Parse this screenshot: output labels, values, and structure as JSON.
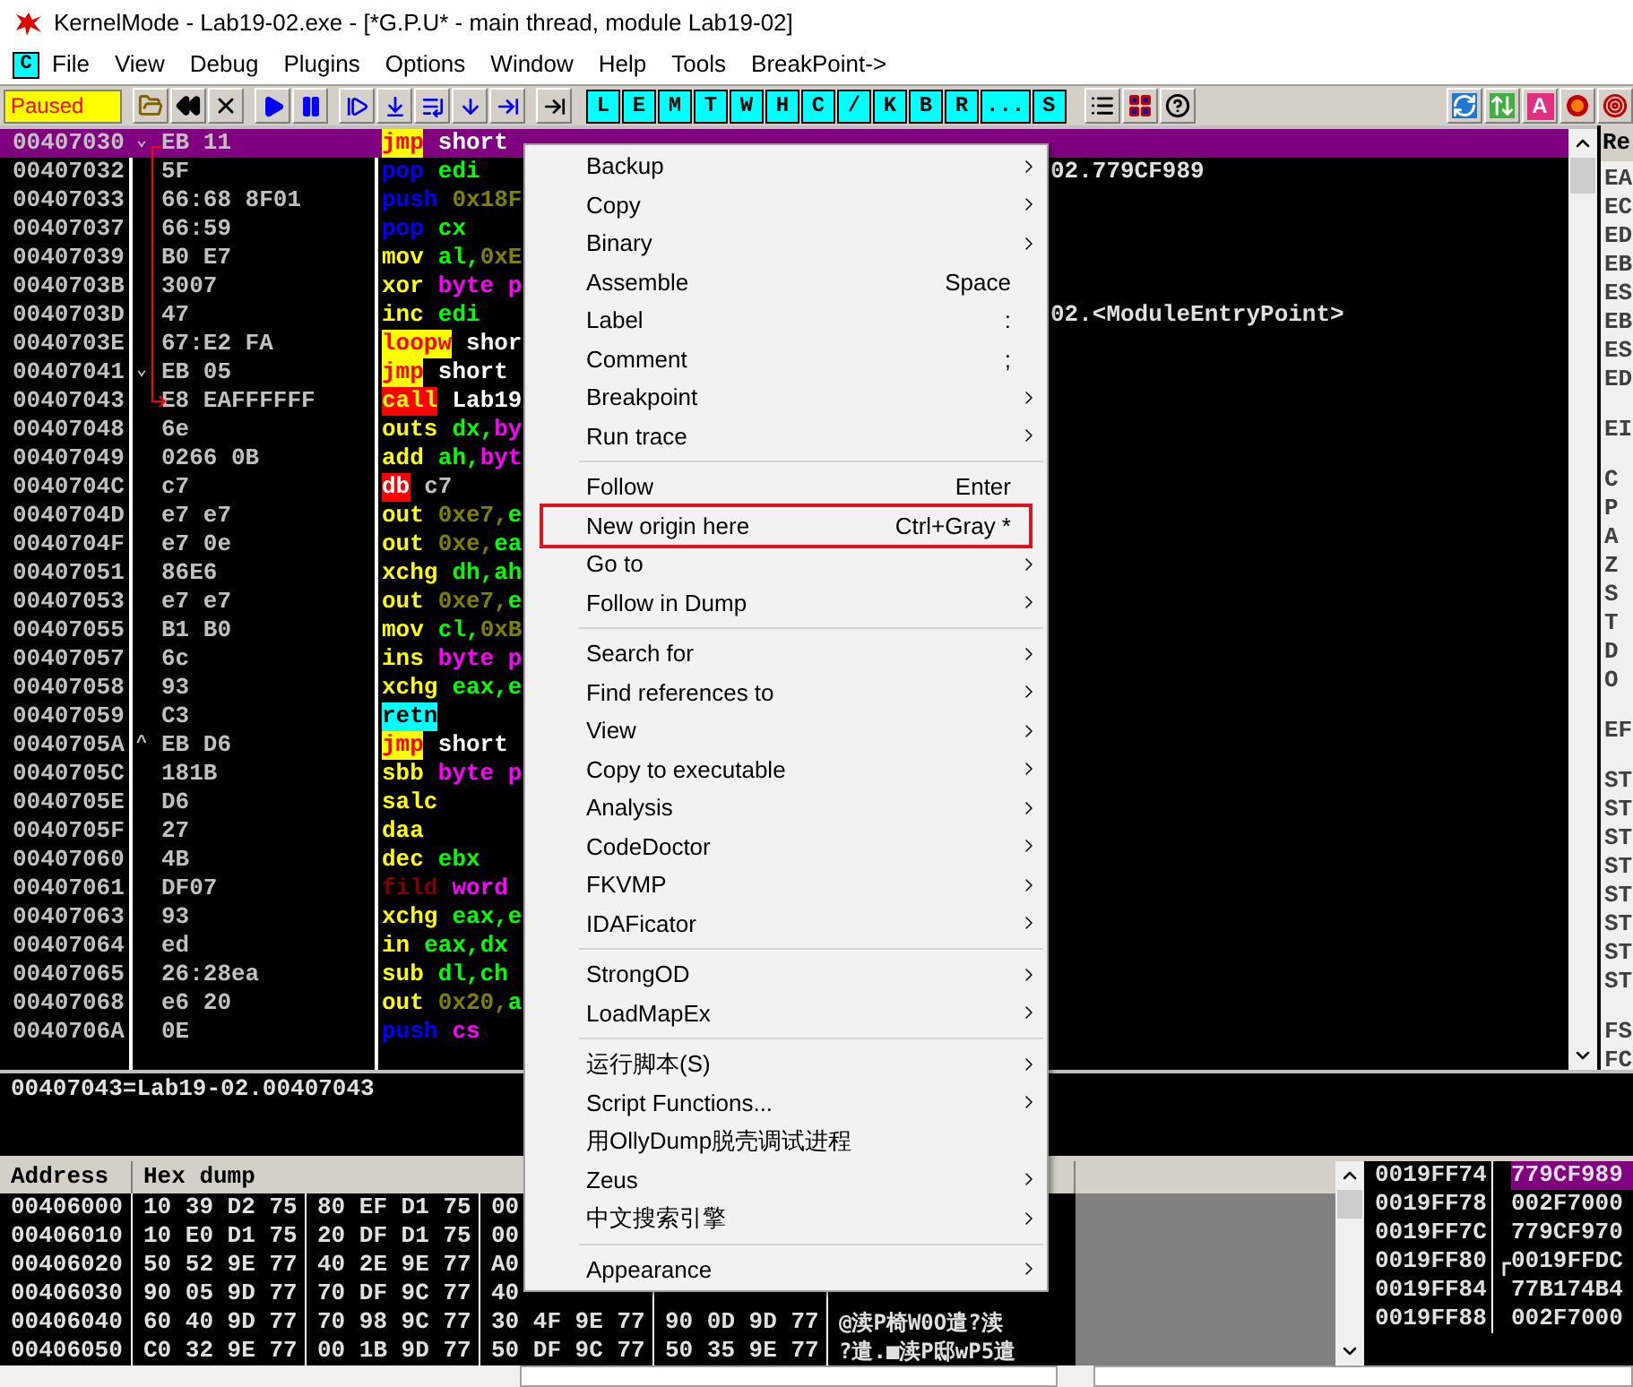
{
  "window": {
    "title": "KernelMode - Lab19-02.exe - [*G.P.U* - main thread, module Lab19-02]"
  },
  "menu_bar": {
    "badge": "C",
    "items": [
      "File",
      "View",
      "Debug",
      "Plugins",
      "Options",
      "Window",
      "Help",
      "Tools",
      "BreakPoint->"
    ]
  },
  "toolbar": {
    "status": "Paused",
    "letter_buttons": [
      "L",
      "E",
      "M",
      "T",
      "W",
      "H",
      "C",
      "/",
      "K",
      "B",
      "R",
      "...",
      "S"
    ],
    "letter_badge": "A"
  },
  "disassembly": {
    "rows": [
      {
        "address": "00407030",
        "marker": "⌄",
        "bytes": "EB 11",
        "selected": true,
        "mnemonic": {
          "text": "jmp",
          "kind": "jump"
        },
        "operands": [
          {
            "text": "short",
            "kind": "label"
          }
        ]
      },
      {
        "address": "00407032",
        "bytes": "5F",
        "comment": "02.779CF989",
        "selected": false,
        "mnemonic": {
          "text": "pop",
          "kind": "stack"
        },
        "operands": [
          {
            "text": "edi",
            "kind": "reg"
          }
        ]
      },
      {
        "address": "00407033",
        "bytes": "66:68 8F01",
        "selected": false,
        "mnemonic": {
          "text": "push",
          "kind": "stack"
        },
        "operands": [
          {
            "text": "0x18F",
            "kind": "imm"
          }
        ]
      },
      {
        "address": "00407037",
        "bytes": "66:59",
        "selected": false,
        "mnemonic": {
          "text": "pop",
          "kind": "stack"
        },
        "operands": [
          {
            "text": "cx",
            "kind": "reg"
          }
        ]
      },
      {
        "address": "00407039",
        "bytes": "B0 E7",
        "selected": false,
        "mnemonic": {
          "text": "mov",
          "kind": "op"
        },
        "operands": [
          {
            "text": "al,",
            "kind": "reg"
          },
          {
            "text": "0xE",
            "kind": "imm"
          }
        ]
      },
      {
        "address": "0040703B",
        "bytes": "3007",
        "selected": false,
        "mnemonic": {
          "text": "xor",
          "kind": "op"
        },
        "operands": [
          {
            "text": "byte p",
            "kind": "mem"
          }
        ]
      },
      {
        "address": "0040703D",
        "bytes": "47",
        "comment": "02.<ModuleEntryPoint>",
        "selected": false,
        "mnemonic": {
          "text": "inc",
          "kind": "op"
        },
        "operands": [
          {
            "text": "edi",
            "kind": "reg"
          }
        ]
      },
      {
        "address": "0040703E",
        "bytes": "67:E2 FA",
        "selected": false,
        "mnemonic": {
          "text": "loopw",
          "kind": "jump"
        },
        "operands": [
          {
            "text": "shor",
            "kind": "label"
          }
        ]
      },
      {
        "address": "00407041",
        "marker": "⌄",
        "bytes": "EB 05",
        "selected": false,
        "mnemonic": {
          "text": "jmp",
          "kind": "jump"
        },
        "operands": [
          {
            "text": "short",
            "kind": "label"
          }
        ]
      },
      {
        "address": "00407043",
        "bytes": "E8 EAFFFFFF",
        "selected": false,
        "mnemonic": {
          "text": "call",
          "kind": "call"
        },
        "operands": [
          {
            "text": "Lab19",
            "kind": "label"
          }
        ]
      },
      {
        "address": "00407048",
        "bytes": "6e",
        "selected": false,
        "mnemonic": {
          "text": "outs",
          "kind": "op"
        },
        "operands": [
          {
            "text": "dx,",
            "kind": "reg"
          },
          {
            "text": "by",
            "kind": "mem"
          }
        ]
      },
      {
        "address": "00407049",
        "bytes": "0266 0B",
        "selected": false,
        "mnemonic": {
          "text": "add",
          "kind": "op"
        },
        "operands": [
          {
            "text": "ah,",
            "kind": "reg"
          },
          {
            "text": "byt",
            "kind": "mem"
          }
        ]
      },
      {
        "address": "0040704C",
        "bytes": "c7",
        "selected": false,
        "mnemonic": {
          "text": "db",
          "kind": "bad"
        },
        "operands": [
          {
            "text": "c7",
            "kind": "plain"
          }
        ]
      },
      {
        "address": "0040704D",
        "bytes": "e7 e7",
        "selected": false,
        "mnemonic": {
          "text": "out",
          "kind": "op"
        },
        "operands": [
          {
            "text": "0xe7,",
            "kind": "imm"
          },
          {
            "text": "e",
            "kind": "reg"
          }
        ]
      },
      {
        "address": "0040704F",
        "bytes": "e7 0e",
        "selected": false,
        "mnemonic": {
          "text": "out",
          "kind": "op"
        },
        "operands": [
          {
            "text": "0xe,",
            "kind": "imm"
          },
          {
            "text": "ea",
            "kind": "reg"
          }
        ]
      },
      {
        "address": "00407051",
        "bytes": "86E6",
        "selected": false,
        "mnemonic": {
          "text": "xchg",
          "kind": "op"
        },
        "operands": [
          {
            "text": "dh,ah",
            "kind": "reg"
          }
        ]
      },
      {
        "address": "00407053",
        "bytes": "e7 e7",
        "selected": false,
        "mnemonic": {
          "text": "out",
          "kind": "op"
        },
        "operands": [
          {
            "text": "0xe7,",
            "kind": "imm"
          },
          {
            "text": "e",
            "kind": "reg"
          }
        ]
      },
      {
        "address": "00407055",
        "bytes": "B1 B0",
        "selected": false,
        "mnemonic": {
          "text": "mov",
          "kind": "op"
        },
        "operands": [
          {
            "text": "cl,",
            "kind": "reg"
          },
          {
            "text": "0xB",
            "kind": "imm"
          }
        ]
      },
      {
        "address": "00407057",
        "bytes": "6c",
        "selected": false,
        "mnemonic": {
          "text": "ins",
          "kind": "op"
        },
        "operands": [
          {
            "text": "byte p",
            "kind": "mem"
          }
        ]
      },
      {
        "address": "00407058",
        "bytes": "93",
        "selected": false,
        "mnemonic": {
          "text": "xchg",
          "kind": "op"
        },
        "operands": [
          {
            "text": "eax,e",
            "kind": "reg"
          }
        ]
      },
      {
        "address": "00407059",
        "bytes": "C3",
        "selected": false,
        "mnemonic": {
          "text": "retn",
          "kind": "ret"
        },
        "operands": []
      },
      {
        "address": "0040705A",
        "marker": "^",
        "bytes": "EB D6",
        "selected": false,
        "mnemonic": {
          "text": "jmp",
          "kind": "jump"
        },
        "operands": [
          {
            "text": "short",
            "kind": "label"
          }
        ]
      },
      {
        "address": "0040705C",
        "bytes": "181B",
        "selected": false,
        "mnemonic": {
          "text": "sbb",
          "kind": "op"
        },
        "operands": [
          {
            "text": "byte p",
            "kind": "mem"
          }
        ]
      },
      {
        "address": "0040705E",
        "bytes": "D6",
        "selected": false,
        "mnemonic": {
          "text": "salc",
          "kind": "op"
        },
        "operands": []
      },
      {
        "address": "0040705F",
        "bytes": "27",
        "selected": false,
        "mnemonic": {
          "text": "daa",
          "kind": "op"
        },
        "operands": []
      },
      {
        "address": "00407060",
        "bytes": "4B",
        "selected": false,
        "mnemonic": {
          "text": "dec",
          "kind": "op"
        },
        "operands": [
          {
            "text": "ebx",
            "kind": "reg"
          }
        ]
      },
      {
        "address": "00407061",
        "bytes": "DF07",
        "selected": false,
        "mnemonic": {
          "text": "fild",
          "kind": "fpu"
        },
        "operands": [
          {
            "text": "word",
            "kind": "mem"
          }
        ]
      },
      {
        "address": "00407063",
        "bytes": "93",
        "selected": false,
        "mnemonic": {
          "text": "xchg",
          "kind": "op"
        },
        "operands": [
          {
            "text": "eax,e",
            "kind": "reg"
          }
        ]
      },
      {
        "address": "00407064",
        "bytes": "ed",
        "selected": false,
        "mnemonic": {
          "text": "in",
          "kind": "op"
        },
        "operands": [
          {
            "text": "eax,dx",
            "kind": "reg"
          }
        ]
      },
      {
        "address": "00407065",
        "bytes": "26:28ea",
        "selected": false,
        "mnemonic": {
          "text": "sub",
          "kind": "op"
        },
        "operands": [
          {
            "text": "dl,ch",
            "kind": "reg"
          }
        ]
      },
      {
        "address": "00407068",
        "bytes": "e6 20",
        "selected": false,
        "mnemonic": {
          "text": "out",
          "kind": "op"
        },
        "operands": [
          {
            "text": "0x20,",
            "kind": "imm"
          },
          {
            "text": "a",
            "kind": "reg"
          }
        ]
      },
      {
        "address": "0040706A",
        "bytes": "0E",
        "selected": false,
        "mnemonic": {
          "text": "push",
          "kind": "stack"
        },
        "operands": [
          {
            "text": "cs",
            "kind": "mem"
          }
        ]
      }
    ]
  },
  "registers": {
    "header": "Re",
    "groups": [
      [
        "EA",
        "EC",
        "ED",
        "EB",
        "ES",
        "EB",
        "ES",
        "ED"
      ],
      [
        "EI"
      ],
      [
        "C",
        "P",
        "A",
        "Z",
        "S",
        "T",
        "D",
        "O"
      ],
      [
        "EF"
      ],
      [
        "ST",
        "ST",
        "ST",
        "ST",
        "ST",
        "ST",
        "ST",
        "ST"
      ],
      [
        "FS",
        "FC"
      ]
    ]
  },
  "info_pane": {
    "text": "00407043=Lab19-02.00407043"
  },
  "dump": {
    "columns": [
      "Address",
      "Hex dump"
    ],
    "rows": [
      {
        "address": "00406000",
        "hex": [
          "10 39 D2 75",
          "80 EF D1 75",
          "00"
        ]
      },
      {
        "address": "00406010",
        "hex": [
          "10 E0 D1 75",
          "20 DF D1 75",
          "00"
        ]
      },
      {
        "address": "00406020",
        "hex": [
          "50 52 9E 77",
          "40 2E 9E 77",
          "A0"
        ]
      },
      {
        "address": "00406030",
        "hex": [
          "90 05 9D 77",
          "70 DF 9C 77",
          "40"
        ]
      },
      {
        "address": "00406040",
        "hex": [
          "60 40 9D 77",
          "70 98 9C 77",
          "30 4F 9E 77",
          "90 0D 9D 77"
        ],
        "ascii": "@渎P椅W0O遣?渎"
      },
      {
        "address": "00406050",
        "hex": [
          "C0 32 9E 77",
          "00 1B 9D 77",
          "50 DF 9C 77",
          "50 35 9E 77"
        ],
        "ascii": "?遣.■渎P邸wP5遣"
      }
    ]
  },
  "stack": {
    "rows": [
      {
        "address": "0019FF74",
        "value": "779CF989",
        "selected": true,
        "frame_start": false
      },
      {
        "address": "0019FF78",
        "value": "002F7000",
        "selected": false,
        "frame_start": false
      },
      {
        "address": "0019FF7C",
        "value": "779CF970",
        "selected": false,
        "frame_start": false
      },
      {
        "address": "0019FF80",
        "value": "0019FFDC",
        "selected": false,
        "frame_start": true
      },
      {
        "address": "0019FF84",
        "value": "77B174B4",
        "selected": false,
        "frame_start": false
      },
      {
        "address": "0019FF88",
        "value": "002F7000",
        "selected": false,
        "frame_start": false
      }
    ]
  },
  "context_menu": {
    "groups": [
      [
        {
          "label": "Backup",
          "submenu": true,
          "outlined": false
        },
        {
          "label": "Copy",
          "submenu": true,
          "outlined": false
        },
        {
          "label": "Binary",
          "submenu": true,
          "outlined": false
        },
        {
          "label": "Assemble",
          "shortcut": "Space",
          "submenu": false,
          "outlined": false
        },
        {
          "label": "Label",
          "shortcut": ":",
          "submenu": false,
          "outlined": false
        },
        {
          "label": "Comment",
          "shortcut": ";",
          "submenu": false,
          "outlined": false
        },
        {
          "label": "Breakpoint",
          "submenu": true,
          "outlined": false
        },
        {
          "label": "Run trace",
          "submenu": true,
          "outlined": false
        }
      ],
      [
        {
          "label": "Follow",
          "shortcut": "Enter",
          "submenu": false,
          "outlined": false
        },
        {
          "label": "New origin here",
          "shortcut": "Ctrl+Gray *",
          "submenu": false,
          "outlined": true
        },
        {
          "label": "Go to",
          "submenu": true,
          "outlined": false
        },
        {
          "label": "Follow in Dump",
          "submenu": true,
          "outlined": false
        }
      ],
      [
        {
          "label": "Search for",
          "submenu": true,
          "outlined": false
        },
        {
          "label": "Find references to",
          "submenu": true,
          "outlined": false
        },
        {
          "label": "View",
          "submenu": true,
          "outlined": false
        },
        {
          "label": "Copy to executable",
          "submenu": true,
          "outlined": false
        },
        {
          "label": "Analysis",
          "submenu": true,
          "outlined": false
        },
        {
          "label": "CodeDoctor",
          "submenu": true,
          "outlined": false
        },
        {
          "label": "FKVMP",
          "submenu": true,
          "outlined": false
        },
        {
          "label": "IDAFicator",
          "submenu": true,
          "outlined": false
        }
      ],
      [
        {
          "label": "StrongOD",
          "submenu": true,
          "outlined": false
        },
        {
          "label": "LoadMapEx",
          "submenu": true,
          "outlined": false
        }
      ],
      [
        {
          "label": "运行脚本(S)",
          "submenu": true,
          "outlined": false
        },
        {
          "label": "Script Functions...",
          "submenu": true,
          "outlined": false
        },
        {
          "label": "用OllyDump脱壳调试进程",
          "submenu": false,
          "outlined": false
        },
        {
          "label": "Zeus",
          "submenu": true,
          "outlined": false
        },
        {
          "label": "中文搜索引擎",
          "submenu": true,
          "outlined": false
        }
      ],
      [
        {
          "label": "Appearance",
          "submenu": true,
          "outlined": false
        }
      ]
    ]
  }
}
